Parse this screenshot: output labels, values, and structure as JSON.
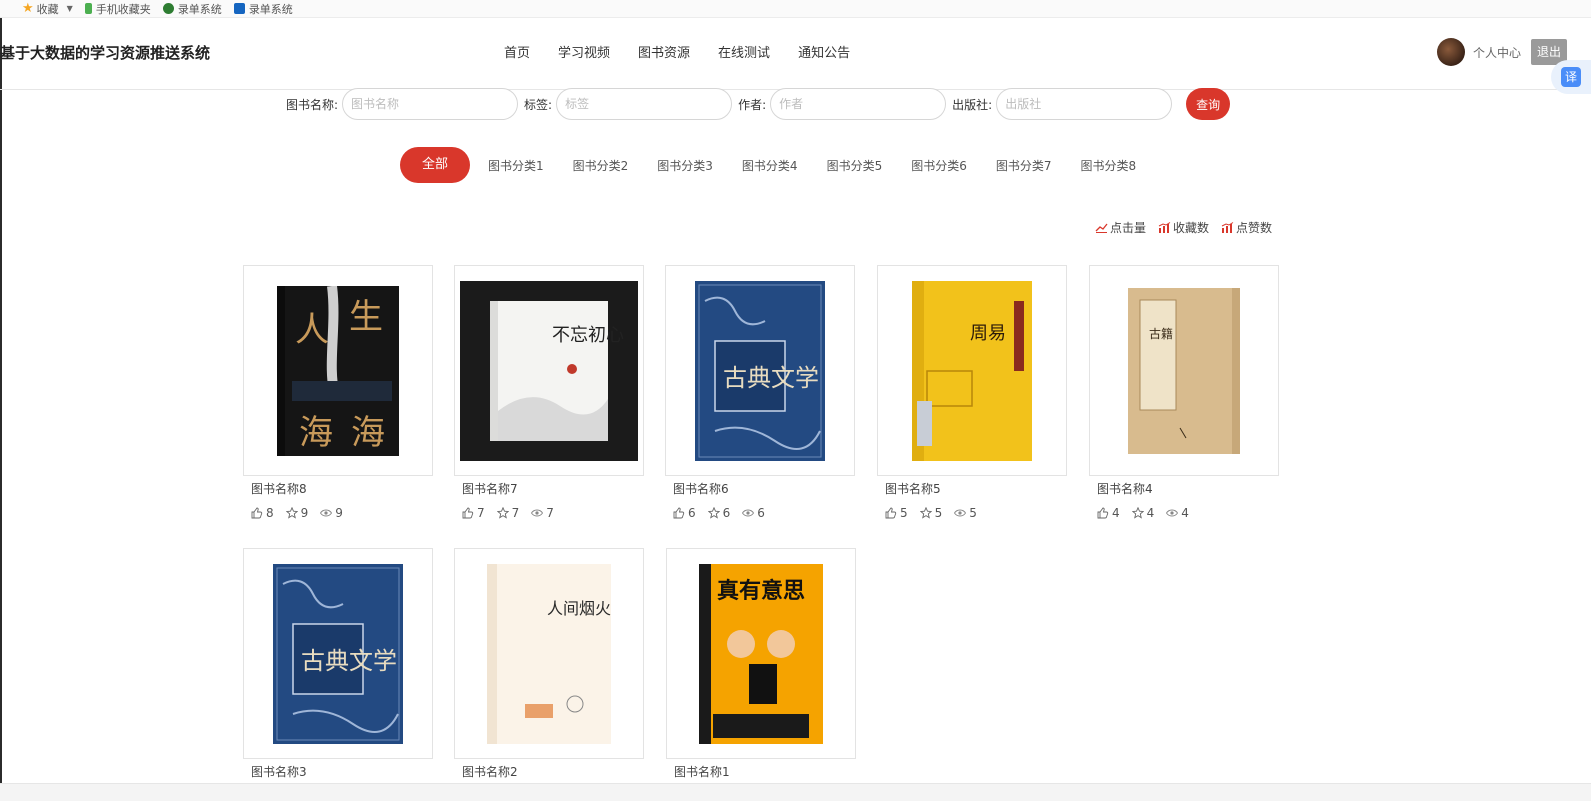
{
  "bookmarks": [
    {
      "label": "收藏",
      "kind": "star"
    },
    {
      "label": "手机收藏夹",
      "kind": "phone",
      "color": "#4caf50"
    },
    {
      "label": "录单系统",
      "kind": "leaf",
      "color": "#2e7d32"
    },
    {
      "label": "录单系统",
      "kind": "rs",
      "color": "#1565c0"
    }
  ],
  "header": {
    "title": "基于大数据的学习资源推送系统",
    "nav": [
      "首页",
      "学习视频",
      "图书资源",
      "在线测试",
      "通知公告"
    ],
    "active_nav": "图书资源",
    "user_center": "个人中心",
    "logout": "退出",
    "translate": "译"
  },
  "search": {
    "name_label": "图书名称:",
    "name_placeholder": "图书名称",
    "tag_label": "标签:",
    "tag_placeholder": "标签",
    "author_label": "作者:",
    "author_placeholder": "作者",
    "publisher_label": "出版社:",
    "publisher_placeholder": "出版社",
    "query_button": "查询"
  },
  "categories": {
    "all": "全部",
    "items": [
      "图书分类1",
      "图书分类2",
      "图书分类3",
      "图书分类4",
      "图书分类5",
      "图书分类6",
      "图书分类7",
      "图书分类8"
    ]
  },
  "sorts": [
    "点击量",
    "收藏数",
    "点赞数"
  ],
  "accent_color": "#d9372b",
  "books": [
    {
      "name": "图书名称8",
      "likes": "8",
      "favorites": "9",
      "views": "9",
      "cover": "人生海海"
    },
    {
      "name": "图书名称7",
      "likes": "7",
      "favorites": "7",
      "views": "7",
      "cover": "不忘初心"
    },
    {
      "name": "图书名称6",
      "likes": "6",
      "favorites": "6",
      "views": "6",
      "cover": "古典文学"
    },
    {
      "name": "图书名称5",
      "likes": "5",
      "favorites": "5",
      "views": "5",
      "cover": "周易"
    },
    {
      "name": "图书名称4",
      "likes": "4",
      "favorites": "4",
      "views": "4",
      "cover": "古籍"
    },
    {
      "name": "图书名称3",
      "likes": "",
      "favorites": "",
      "views": "",
      "cover": "古典文学"
    },
    {
      "name": "图书名称2",
      "likes": "",
      "favorites": "",
      "views": "",
      "cover": "人间烟火"
    },
    {
      "name": "图书名称1",
      "likes": "",
      "favorites": "",
      "views": "",
      "cover": "真有意思"
    }
  ]
}
